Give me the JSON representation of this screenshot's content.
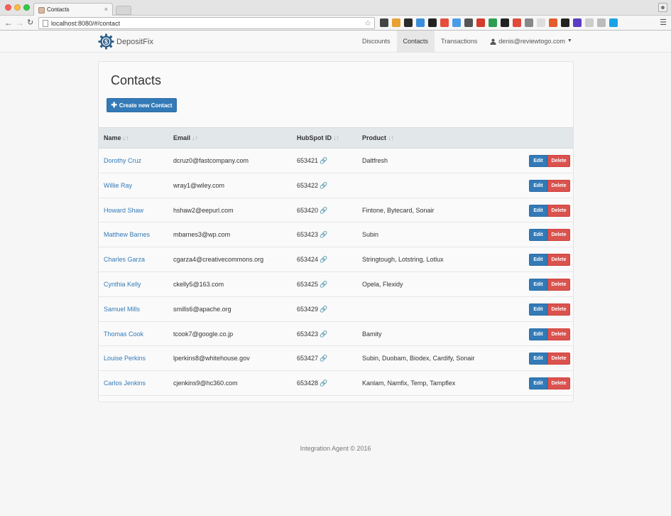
{
  "browser": {
    "tab_title": "Contacts",
    "tab_close": "×",
    "url": "localhost:8080/#/contact",
    "extension_colors": [
      "#444444",
      "#e8a130",
      "#2a2a2a",
      "#3b8fd8",
      "#222222",
      "#e74c3c",
      "#4b9ce8",
      "#555555",
      "#d33b2c",
      "#2d9e4f",
      "#222222",
      "#e04a3a",
      "#888888",
      "#dddddd",
      "#e55b2c",
      "#222222",
      "#5b3cc4",
      "#cccccc",
      "#bbbbbb",
      "#1aa2e6"
    ]
  },
  "appnav": {
    "brand": "DepositFix",
    "links": [
      "Discounts",
      "Contacts",
      "Transactions"
    ],
    "active_link": "Contacts",
    "user": "denis@reviewtogo.com"
  },
  "page": {
    "title": "Contacts",
    "create_button": "Create new Contact",
    "columns": [
      "Name",
      "Email",
      "HubSpot ID",
      "Product"
    ],
    "edit_label": "Edit",
    "delete_label": "Delete",
    "rows": [
      {
        "name": "Dorothy Cruz",
        "email": "dcruz0@fastcompany.com",
        "hubspot_id": "653421",
        "product": "Daltfresh"
      },
      {
        "name": "Willie Ray",
        "email": "wray1@wiley.com",
        "hubspot_id": "653422",
        "product": ""
      },
      {
        "name": "Howard Shaw",
        "email": "hshaw2@eepurl.com",
        "hubspot_id": "653420",
        "product": "Fintone, Bytecard, Sonair"
      },
      {
        "name": "Matthew Barnes",
        "email": "mbarnes3@wp.com",
        "hubspot_id": "653423",
        "product": "Subin"
      },
      {
        "name": "Charles Garza",
        "email": "cgarza4@creativecommons.org",
        "hubspot_id": "653424",
        "product": "Stringtough, Lotstring, Lotlux"
      },
      {
        "name": "Cynthia Kelly",
        "email": "ckelly5@163.com",
        "hubspot_id": "653425",
        "product": "Opela, Flexidy"
      },
      {
        "name": "Samuel Mills",
        "email": "smills6@apache.org",
        "hubspot_id": "653429",
        "product": ""
      },
      {
        "name": "Thomas Cook",
        "email": "tcook7@google.co.jp",
        "hubspot_id": "653423",
        "product": "Bamity"
      },
      {
        "name": "Louise Perkins",
        "email": "lperkins8@whitehouse.gov",
        "hubspot_id": "653427",
        "product": "Subin, Duobam, Biodex, Cardify, Sonair"
      },
      {
        "name": "Carlos Jenkins",
        "email": "cjenkins9@hc360.com",
        "hubspot_id": "653428",
        "product": "Kanlam, Namfix, Temp, Tampflex"
      }
    ]
  },
  "footer": "Integration Agent © 2016",
  "colors": {
    "primary": "#337ab7",
    "danger": "#d9534f",
    "table_header": "#e2e7ea",
    "brand_logo": "#2f5f8a"
  }
}
